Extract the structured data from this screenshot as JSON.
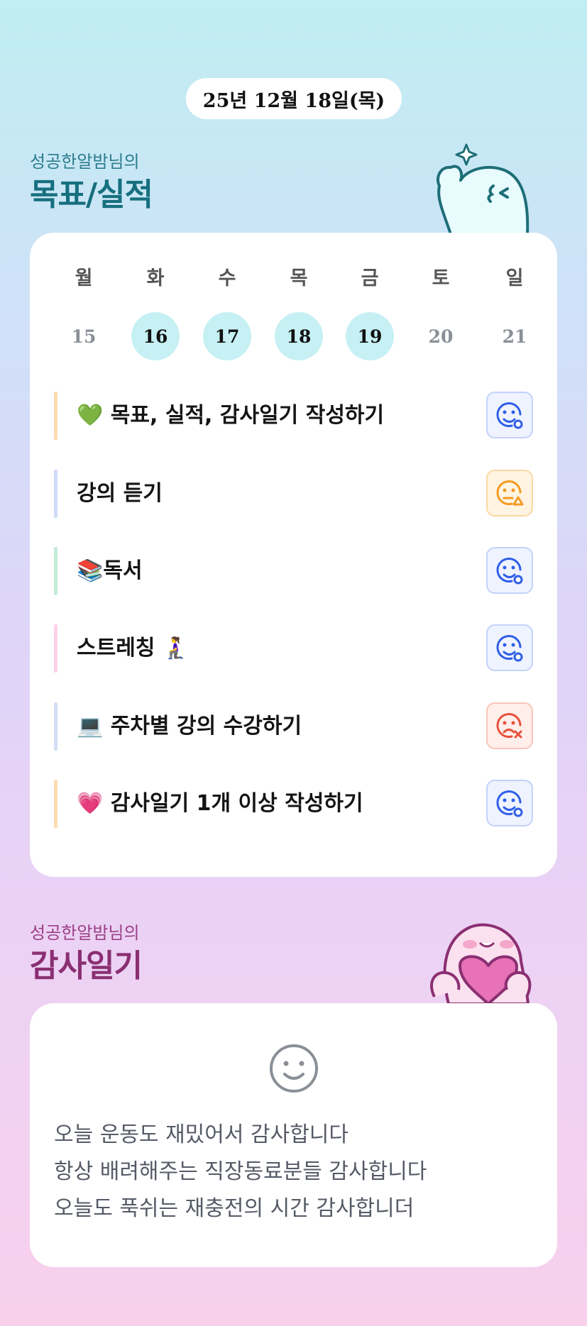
{
  "date": "25년 12월 18일(목)",
  "goals_section": {
    "subtitle": "성공한알밤님의",
    "title": "목표/실적"
  },
  "week": {
    "days": [
      {
        "label": "월",
        "num": "15",
        "active": false
      },
      {
        "label": "화",
        "num": "16",
        "active": true
      },
      {
        "label": "수",
        "num": "17",
        "active": true
      },
      {
        "label": "목",
        "num": "18",
        "active": true
      },
      {
        "label": "금",
        "num": "19",
        "active": true
      },
      {
        "label": "토",
        "num": "20",
        "active": false
      },
      {
        "label": "일",
        "num": "21",
        "active": false
      }
    ]
  },
  "goals": [
    {
      "text": "💚 목표, 실적, 감사일기 작성하기",
      "bar_color": "#fddcb0",
      "status": "done"
    },
    {
      "text": "강의 듣기",
      "bar_color": "#cfdcf8",
      "status": "partial"
    },
    {
      "text": "📚독서",
      "bar_color": "#c2ecd6",
      "status": "done"
    },
    {
      "text": "스트레칭 🧎‍♀️",
      "bar_color": "#fcd2e8",
      "status": "done"
    },
    {
      "text": "💻 주차별 강의 수강하기",
      "bar_color": "#d4dcf8",
      "status": "failed"
    },
    {
      "text": "💗 감사일기 1개 이상 작성하기",
      "bar_color": "#fddcb0",
      "status": "done"
    }
  ],
  "status_icons": {
    "done": {
      "icon": "smile-check-icon",
      "color": "#2f5ee8"
    },
    "partial": {
      "icon": "neutral-warning-icon",
      "color": "#f39a21"
    },
    "failed": {
      "icon": "sad-x-icon",
      "color": "#e8503a"
    }
  },
  "diary_section": {
    "subtitle": "성공한알밤님의",
    "title": "감사일기"
  },
  "diary": {
    "icon": "smile-icon",
    "lines": [
      "오늘 운동도 재밌어서 감사합니다",
      "항상 배려해주는 직장동료분들 감사합니다",
      "오늘도 푹쉬는 재충전의 시간 감사합니더"
    ]
  }
}
